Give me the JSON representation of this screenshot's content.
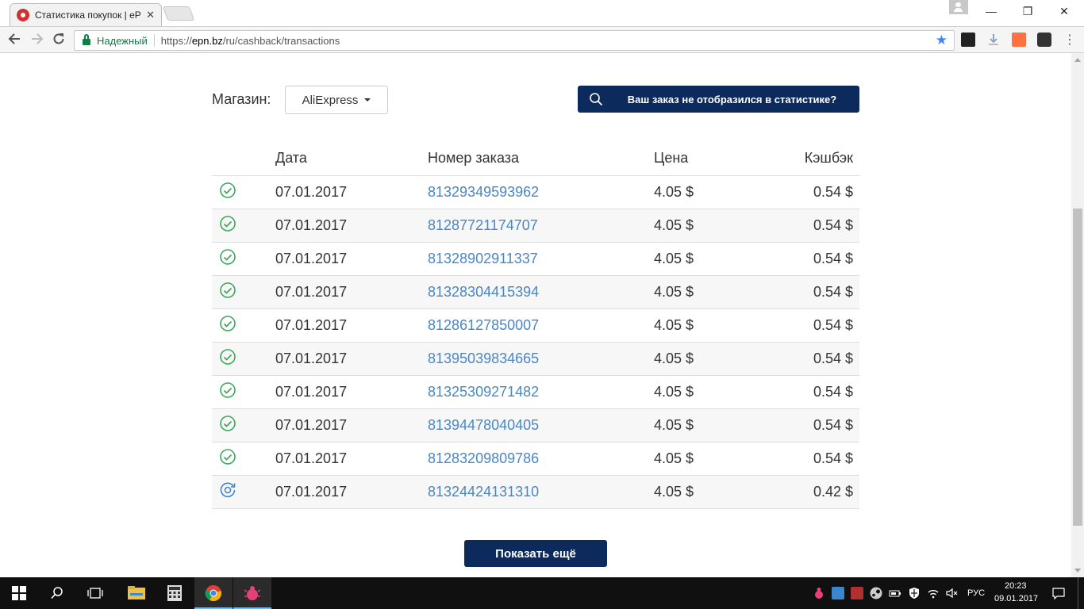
{
  "browser": {
    "tab_title": "Статистика покупок | eP",
    "tab_close": "✕",
    "secure_label": "Надежный",
    "url_prefix": "https://",
    "url_host": "epn.bz",
    "url_path": "/ru/cashback/transactions",
    "window_controls": {
      "minimize": "—",
      "maximize": "❐",
      "close": "✕"
    }
  },
  "filter": {
    "store_label": "Магазин:",
    "store_value": "AliExpress",
    "missing_order_button": "Ваш заказ не отобразился в статистике?"
  },
  "table": {
    "headers": {
      "date": "Дата",
      "order": "Номер заказа",
      "price": "Цена",
      "cashback": "Кэшбэк"
    },
    "rows": [
      {
        "status": "confirmed",
        "date": "07.01.2017",
        "order": "81329349593962",
        "price": "4.05 $",
        "cashback": "0.54 $"
      },
      {
        "status": "confirmed",
        "date": "07.01.2017",
        "order": "81287721174707",
        "price": "4.05 $",
        "cashback": "0.54 $"
      },
      {
        "status": "confirmed",
        "date": "07.01.2017",
        "order": "81328902911337",
        "price": "4.05 $",
        "cashback": "0.54 $"
      },
      {
        "status": "confirmed",
        "date": "07.01.2017",
        "order": "81328304415394",
        "price": "4.05 $",
        "cashback": "0.54 $"
      },
      {
        "status": "confirmed",
        "date": "07.01.2017",
        "order": "81286127850007",
        "price": "4.05 $",
        "cashback": "0.54 $"
      },
      {
        "status": "confirmed",
        "date": "07.01.2017",
        "order": "81395039834665",
        "price": "4.05 $",
        "cashback": "0.54 $"
      },
      {
        "status": "confirmed",
        "date": "07.01.2017",
        "order": "81325309271482",
        "price": "4.05 $",
        "cashback": "0.54 $"
      },
      {
        "status": "confirmed",
        "date": "07.01.2017",
        "order": "81394478040405",
        "price": "4.05 $",
        "cashback": "0.54 $"
      },
      {
        "status": "confirmed",
        "date": "07.01.2017",
        "order": "81283209809786",
        "price": "4.05 $",
        "cashback": "0.54 $"
      },
      {
        "status": "pending",
        "date": "07.01.2017",
        "order": "81324424131310",
        "price": "4.05 $",
        "cashback": "0.42 $"
      }
    ]
  },
  "show_more_button": "Показать ещё",
  "taskbar": {
    "language": "РУС",
    "time": "20:23",
    "date": "09.01.2017"
  },
  "colors": {
    "accent_navy": "#0c2a5c",
    "link_blue": "#4a86c5",
    "cashback_red": "#e03645",
    "status_green": "#3aaa5a",
    "status_pending_blue": "#3a86d0"
  }
}
